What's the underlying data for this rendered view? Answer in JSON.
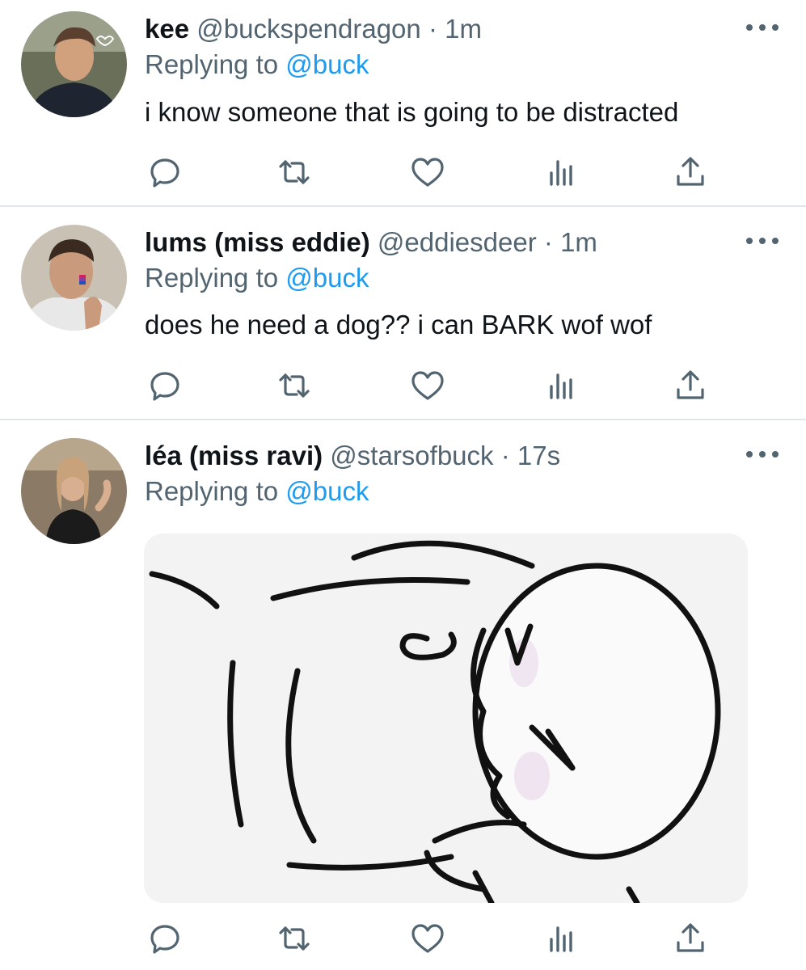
{
  "tweets": [
    {
      "name": "kee",
      "handle": "@buckspendragon",
      "separator": "·",
      "time": "1m",
      "replying_prefix": "Replying to",
      "replying_to": "@buck",
      "text": "i know someone that is going to be distracted",
      "avatar_colors": {
        "bg": "#6a6f5a",
        "skin": "#d1a07c",
        "shirt": "#1e2430"
      }
    },
    {
      "name": "lums (miss eddie)",
      "handle": "@eddiesdeer",
      "separator": "·",
      "time": "1m",
      "replying_prefix": "Replying to",
      "replying_to": "@buck",
      "text": "does he need a dog?? i can BARK wof wof",
      "avatar_colors": {
        "bg": "#c9c2b4",
        "skin": "#c99a7c",
        "shirt": "#e8e8e8"
      }
    },
    {
      "name": "léa (miss ravi)",
      "handle": "@starsofbuck",
      "separator": "·",
      "time": "17s",
      "replying_prefix": "Replying to",
      "replying_to": "@buck",
      "text": "",
      "avatar_colors": {
        "bg": "#8b7a66",
        "skin": "#d8b091",
        "shirt": "#1b1b1b"
      }
    }
  ],
  "icons": [
    "more-icon",
    "reply-icon",
    "retweet-icon",
    "like-icon",
    "analytics-icon",
    "share-icon"
  ],
  "colors": {
    "text": "#0f1419",
    "secondary": "#536471",
    "link": "#1d9bf0",
    "divider": "#e1e6ea"
  }
}
